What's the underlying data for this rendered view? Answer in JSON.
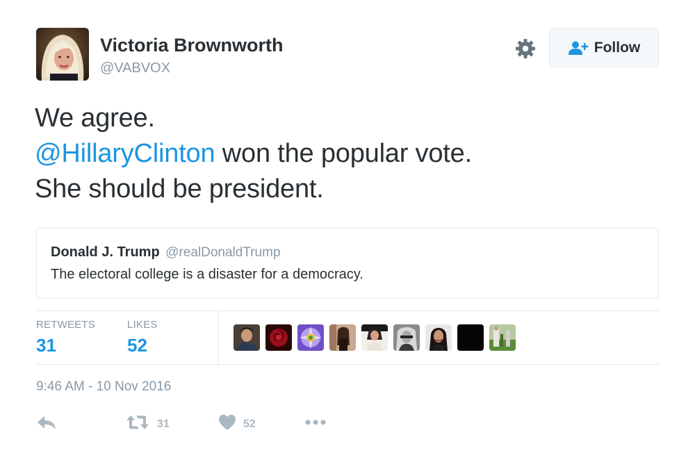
{
  "author": {
    "display_name": "Victoria Brownworth",
    "screen_name": "@VABVOX"
  },
  "follow_button": {
    "label": "Follow",
    "icon": "follow-user-plus-icon"
  },
  "settings_icon": "gear-icon",
  "tweet": {
    "line1": "We agree.",
    "mention": "@HillaryClinton",
    "line2_rest": " won the popular vote.",
    "line3": "She should be president."
  },
  "quoted_tweet": {
    "name": "Donald J. Trump",
    "handle": "@realDonaldTrump",
    "text": "The electoral college is a disaster for a democracy."
  },
  "stats": {
    "retweets_label": "RETWEETS",
    "retweets_value": "31",
    "likes_label": "LIKES",
    "likes_value": "52"
  },
  "likers_count_shown": 9,
  "timestamp": "9:46 AM - 10 Nov 2016",
  "actions": {
    "reply_icon": "reply-icon",
    "retweet_icon": "retweet-icon",
    "retweet_count": "31",
    "like_icon": "heart-icon",
    "like_count": "52",
    "more_icon": "more-dots-icon"
  },
  "colors": {
    "link": "#1b95e0",
    "text": "#292f33",
    "muted": "#8899a6",
    "icon_muted": "#aab8c2",
    "border": "#e1e8ed"
  }
}
